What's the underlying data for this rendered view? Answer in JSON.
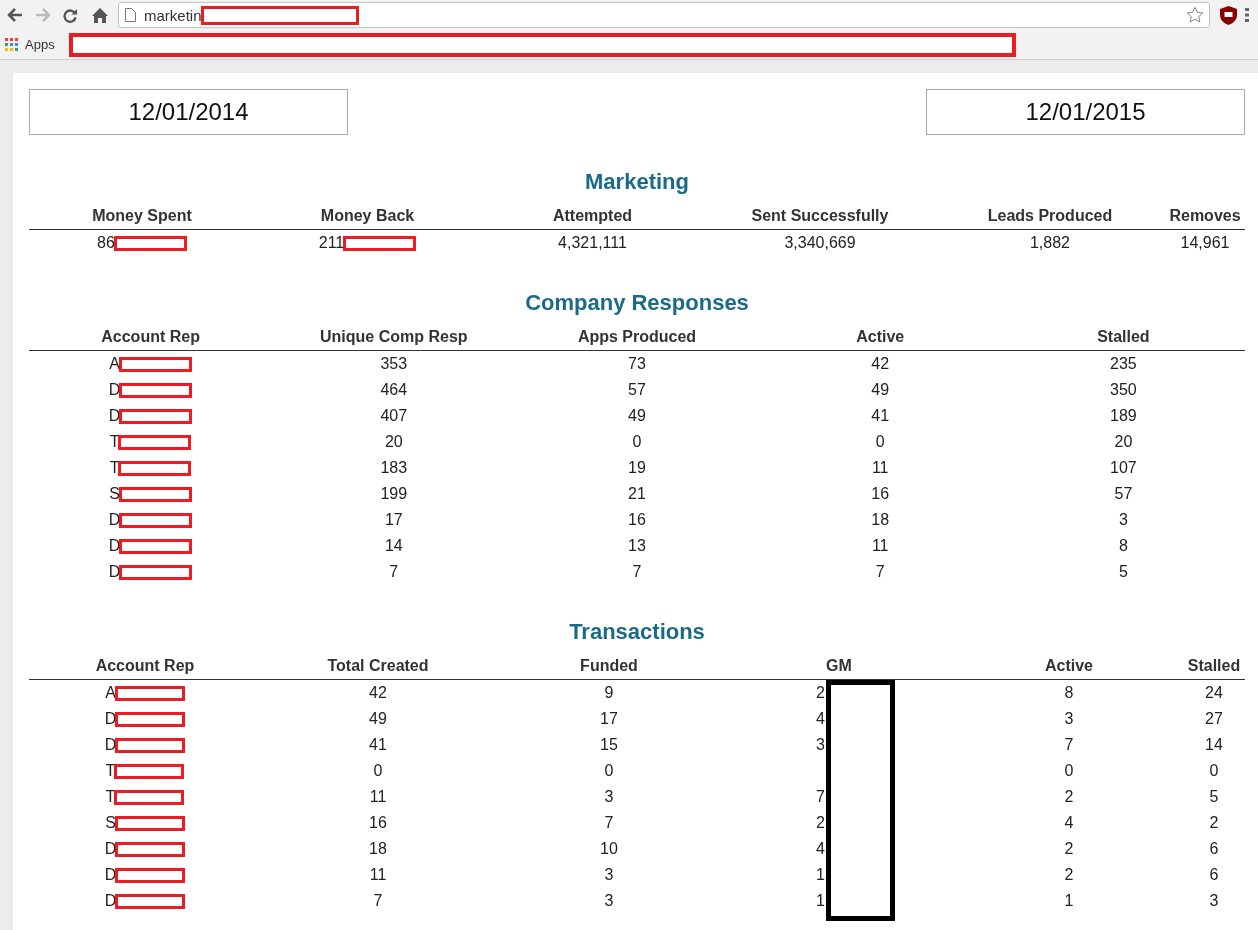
{
  "browser": {
    "url": "marketin",
    "bookmarks": [
      "Apps"
    ]
  },
  "date_range": {
    "start": "12/01/2014",
    "end": "12/01/2015"
  },
  "marketing": {
    "title": "Marketing",
    "columns": [
      "Money Spent",
      "Money Back",
      "Attempted",
      "Sent Successfully",
      "Leads Produced",
      "Removes"
    ],
    "rows": [
      {
        "cells": [
          {
            "text": "86",
            "redacted": true
          },
          {
            "text": "211",
            "redacted": true
          },
          {
            "text": "4,321,111"
          },
          {
            "text": "3,340,669"
          },
          {
            "text": "1,882"
          },
          {
            "text": "14,961"
          }
        ]
      }
    ]
  },
  "company_responses": {
    "title": "Company Responses",
    "columns": [
      "Account Rep",
      "Unique Comp Resp",
      "Apps Produced",
      "Active",
      "Stalled"
    ],
    "rows": [
      {
        "rep": "A",
        "values": [
          "353",
          "73",
          "42",
          "235"
        ]
      },
      {
        "rep": "D",
        "values": [
          "464",
          "57",
          "49",
          "350"
        ]
      },
      {
        "rep": "D",
        "values": [
          "407",
          "49",
          "41",
          "189"
        ]
      },
      {
        "rep": "T",
        "values": [
          "20",
          "0",
          "0",
          "20"
        ]
      },
      {
        "rep": "T",
        "values": [
          "183",
          "19",
          "11",
          "107"
        ]
      },
      {
        "rep": "S",
        "values": [
          "199",
          "21",
          "16",
          "57"
        ]
      },
      {
        "rep": "D",
        "values": [
          "17",
          "16",
          "18",
          "3"
        ]
      },
      {
        "rep": "D",
        "values": [
          "14",
          "13",
          "11",
          "8"
        ]
      },
      {
        "rep": "D",
        "values": [
          "7",
          "7",
          "7",
          "5"
        ]
      }
    ]
  },
  "transactions": {
    "title": "Transactions",
    "columns": [
      "Account Rep",
      "Total Created",
      "Funded",
      "GM",
      "Active",
      "Stalled"
    ],
    "rows": [
      {
        "rep": "A",
        "total_created": "42",
        "funded": "9",
        "gm": "2",
        "active": "8",
        "stalled": "24"
      },
      {
        "rep": "D",
        "total_created": "49",
        "funded": "17",
        "gm": "4",
        "active": "3",
        "stalled": "27"
      },
      {
        "rep": "D",
        "total_created": "41",
        "funded": "15",
        "gm": "3",
        "active": "7",
        "stalled": "14"
      },
      {
        "rep": "T",
        "total_created": "0",
        "funded": "0",
        "active": "0",
        "stalled": "0"
      },
      {
        "rep": "T",
        "total_created": "11",
        "funded": "3",
        "gm": "7",
        "active": "2",
        "stalled": "5"
      },
      {
        "rep": "S",
        "total_created": "16",
        "funded": "7",
        "gm": "2",
        "active": "4",
        "stalled": "2"
      },
      {
        "rep": "D",
        "total_created": "18",
        "funded": "10",
        "gm": "4",
        "active": "2",
        "stalled": "6"
      },
      {
        "rep": "D",
        "total_created": "11",
        "funded": "3",
        "gm": "1",
        "active": "2",
        "stalled": "6"
      },
      {
        "rep": "D",
        "total_created": "7",
        "funded": "3",
        "gm": "1",
        "active": "1",
        "stalled": "3"
      }
    ]
  }
}
